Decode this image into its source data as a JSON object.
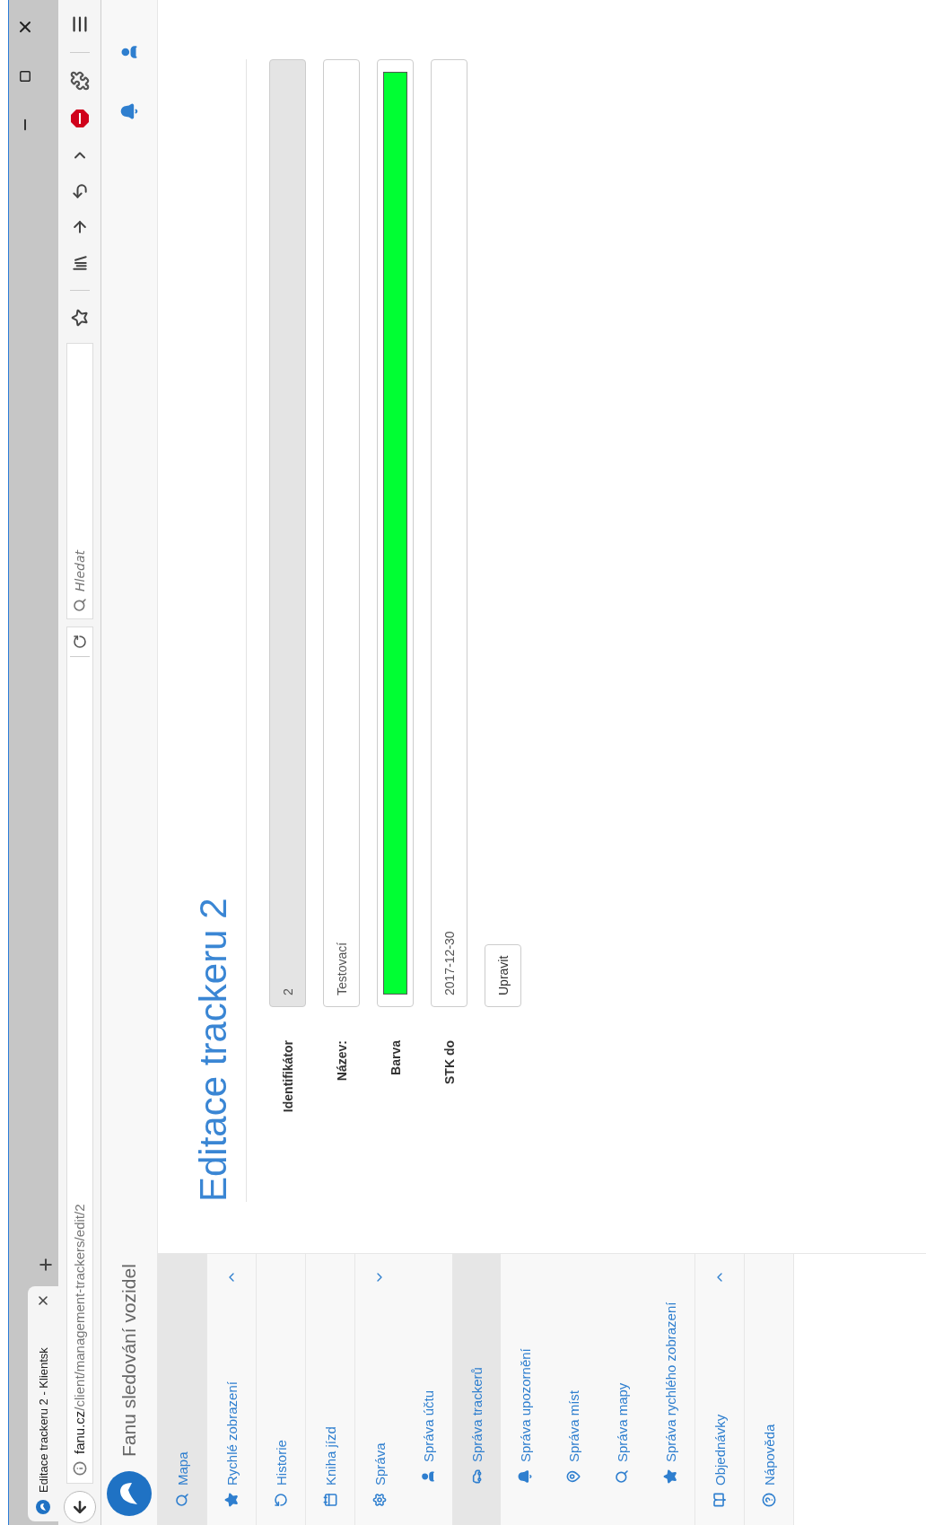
{
  "browser": {
    "tab": {
      "title": "Editace trackeru 2 - Klientsk",
      "selected": true
    },
    "url": "fanu.cz/client/management-trackers/edit/2",
    "search": {
      "placeholder": "Hledat"
    }
  },
  "app": {
    "title": "Fanu sledování vozidel"
  },
  "sidebar": {
    "items": [
      {
        "label": "Mapa",
        "selected": true
      },
      {
        "label": "Rychlé zobrazení",
        "selected": false,
        "expanded": false
      },
      {
        "label": "Historie",
        "selected": false
      },
      {
        "label": "Kniha jízd",
        "selected": false
      },
      {
        "label": "Správa",
        "selected": false,
        "expanded": true,
        "children": [
          {
            "label": "Správa účtu",
            "selected": false
          },
          {
            "label": "Správa trackerů",
            "selected": true
          },
          {
            "label": "Správa upozornění",
            "selected": false
          },
          {
            "label": "Správa míst",
            "selected": false
          },
          {
            "label": "Správa mapy",
            "selected": false
          },
          {
            "label": "Správa rychlého zobrazení",
            "selected": false
          }
        ]
      },
      {
        "label": "Objednávky",
        "selected": false,
        "expanded": false
      },
      {
        "label": "Nápověda",
        "selected": false
      }
    ]
  },
  "form": {
    "title": "Editace trackeru 2",
    "fields": [
      {
        "label": "Identifikátor",
        "kind": "text",
        "value": "2",
        "disabled": true
      },
      {
        "label": "Název:",
        "kind": "text",
        "value": "Testovací",
        "disabled": false
      },
      {
        "label": "Barva",
        "kind": "color",
        "color": "#00ff33"
      },
      {
        "label": "STK do",
        "kind": "text",
        "value": "2017-12-30",
        "disabled": false
      }
    ],
    "submit": "Upravit"
  }
}
